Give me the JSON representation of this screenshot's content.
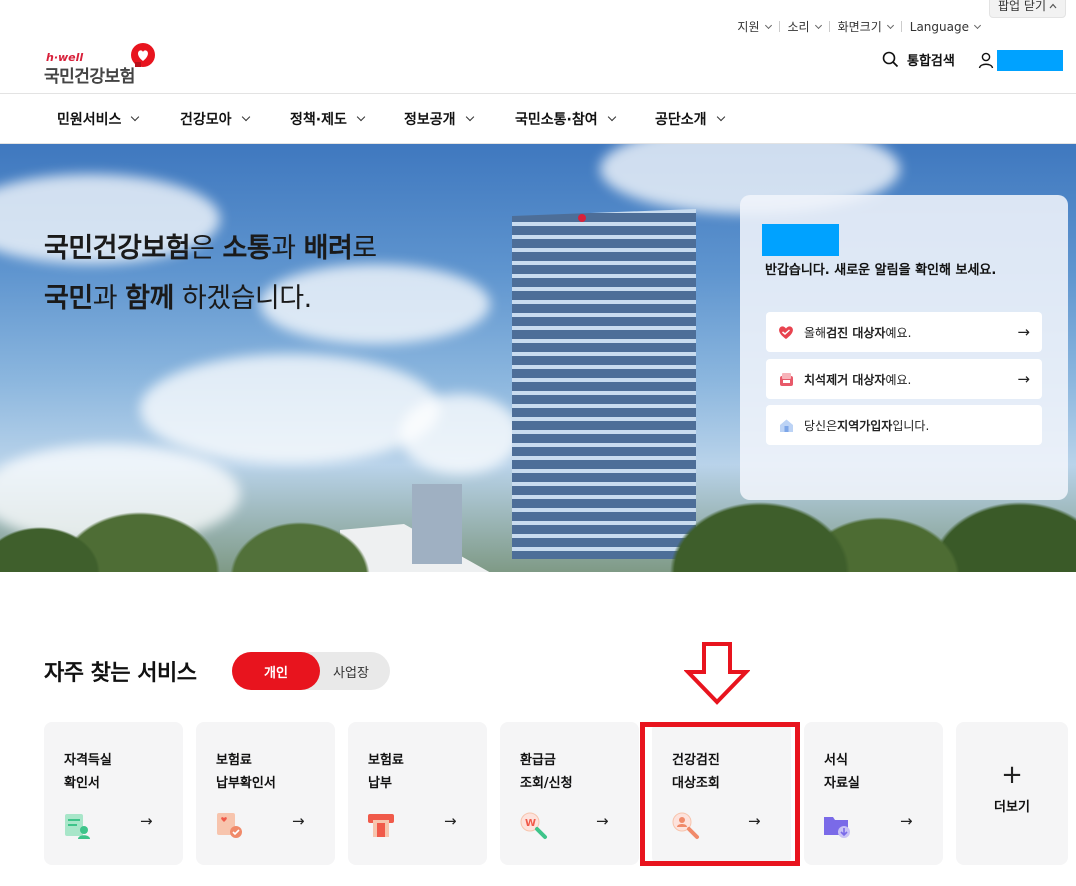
{
  "util": {
    "popup_close": "팝업 닫기",
    "items": [
      "지원",
      "소리",
      "화면크기"
    ],
    "language": "Language"
  },
  "logo": {
    "small": "h·well",
    "main": "국민건강보험"
  },
  "header": {
    "search": "통합검색"
  },
  "nav": [
    {
      "label": "민원서비스"
    },
    {
      "label": "건강모아"
    },
    {
      "label": "정책·제도"
    },
    {
      "label": "정보공개"
    },
    {
      "label": "국민소통·참여"
    },
    {
      "label": "공단소개"
    }
  ],
  "hero": {
    "line1": [
      {
        "t": "국민건강보험",
        "b": true
      },
      {
        "t": "은 ",
        "b": false
      },
      {
        "t": "소통",
        "b": true
      },
      {
        "t": "과 ",
        "b": false
      },
      {
        "t": "배려",
        "b": true
      },
      {
        "t": "로",
        "b": false
      }
    ],
    "line2": [
      {
        "t": "국민",
        "b": true
      },
      {
        "t": "과 ",
        "b": false
      },
      {
        "t": "함께",
        "b": true
      },
      {
        "t": " 하겠습니다.",
        "b": false
      }
    ]
  },
  "notice": {
    "message": "반갑습니다. 새로운 알림을 확인해 보세요.",
    "rows": [
      {
        "pre": "올해 ",
        "bold": "검진 대상자",
        "post": "예요.",
        "icon": "heart-check-icon",
        "color": "#e8434f"
      },
      {
        "pre": "",
        "bold": "치석제거 대상자",
        "post": "예요.",
        "icon": "dental-icon",
        "color": "#e85a6a"
      },
      {
        "pre": "당신은 ",
        "bold": "지역가입자",
        "post": "입니다.",
        "icon": "home-icon",
        "color": "#7da6e8"
      }
    ]
  },
  "services": {
    "title": "자주 찾는 서비스",
    "toggle_on": "개인",
    "toggle_off": "사업장",
    "cards": [
      {
        "l1": "자격득실",
        "l2": "확인서",
        "icon": "certificate-icon",
        "color": "#3ec48a"
      },
      {
        "l1": "보험료",
        "l2": "납부확인서",
        "icon": "receipt-icon",
        "color": "#f08a6a"
      },
      {
        "l1": "보험료",
        "l2": "납부",
        "icon": "payment-icon",
        "color": "#f05a4a"
      },
      {
        "l1": "환급금",
        "l2": "조회/신청",
        "icon": "refund-search-icon",
        "color": "#3ec48a"
      },
      {
        "l1": "건강검진",
        "l2": "대상조회",
        "icon": "person-search-icon",
        "color": "#f08a6a"
      },
      {
        "l1": "서식",
        "l2": "자료실",
        "icon": "folder-download-icon",
        "color": "#7a6ae8"
      }
    ],
    "more": "더보기"
  }
}
